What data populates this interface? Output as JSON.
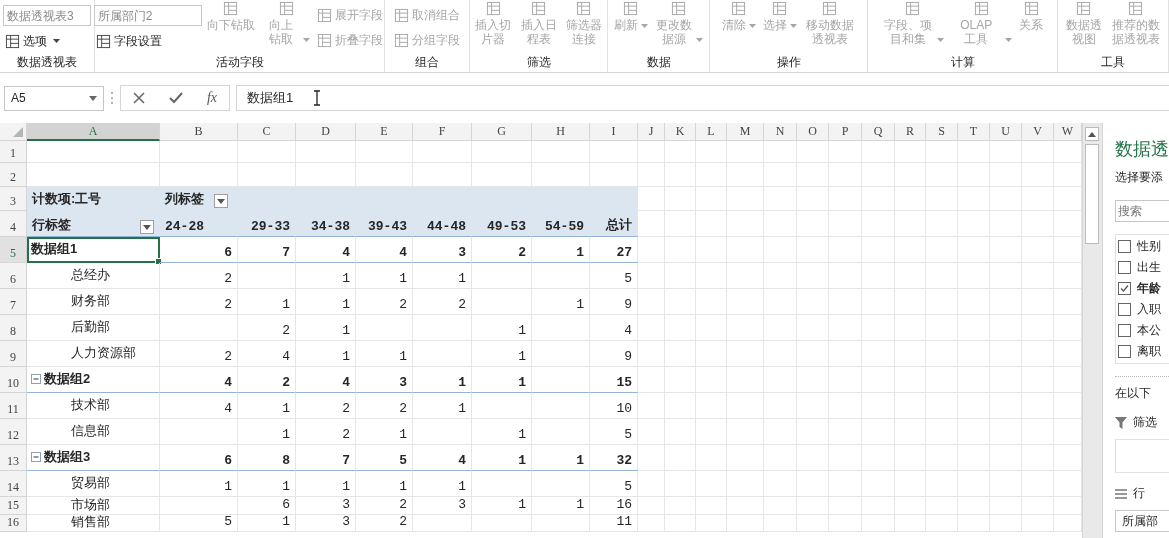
{
  "ribbon": {
    "groups": [
      {
        "name": "数据透视表",
        "items": [
          {
            "kind": "field",
            "label": "数据透视表3"
          },
          {
            "kind": "small",
            "label": "选项",
            "dropdown": true,
            "disabled": false
          }
        ]
      },
      {
        "name": "活动字段",
        "items": [
          {
            "kind": "field",
            "label": "所属部门2"
          },
          {
            "kind": "small",
            "label": "字段设置",
            "dropdown": false,
            "disabled": false
          },
          {
            "kind": "large",
            "label": "向下钻取",
            "dropdown": false,
            "disabled": true
          },
          {
            "kind": "large",
            "label": "向上钻取",
            "dropdown": true,
            "disabled": true
          },
          {
            "kind": "small",
            "label": "展开字段",
            "dropdown": false,
            "disabled": true
          },
          {
            "kind": "small",
            "label": "折叠字段",
            "dropdown": false,
            "disabled": true
          }
        ]
      },
      {
        "name": "组合",
        "items": [
          {
            "kind": "small",
            "label": "取消组合",
            "dropdown": false,
            "disabled": true
          },
          {
            "kind": "small",
            "label": "分组字段",
            "dropdown": false,
            "disabled": true
          }
        ]
      },
      {
        "name": "筛选",
        "items": [
          {
            "kind": "large",
            "label": "插入切片器",
            "dropdown": false,
            "disabled": true
          },
          {
            "kind": "large",
            "label": "插入日程表",
            "dropdown": false,
            "disabled": true
          },
          {
            "kind": "large",
            "label": "筛选器连接",
            "dropdown": false,
            "disabled": true
          }
        ]
      },
      {
        "name": "数据",
        "items": [
          {
            "kind": "large",
            "label": "刷新",
            "dropdown": true,
            "disabled": true
          },
          {
            "kind": "large",
            "label": "更改数据源",
            "dropdown": true,
            "disabled": true
          }
        ]
      },
      {
        "name": "操作",
        "items": [
          {
            "kind": "large",
            "label": "清除",
            "dropdown": true,
            "disabled": true
          },
          {
            "kind": "large",
            "label": "选择",
            "dropdown": true,
            "disabled": true
          },
          {
            "kind": "large",
            "label": "移动数据透视表",
            "dropdown": false,
            "disabled": true
          }
        ]
      },
      {
        "name": "计算",
        "items": [
          {
            "kind": "large",
            "label": "字段、项目和集",
            "dropdown": true,
            "disabled": true
          },
          {
            "kind": "large",
            "label": "OLAP 工具",
            "dropdown": true,
            "disabled": true
          },
          {
            "kind": "large",
            "label": "关系",
            "dropdown": false,
            "disabled": true
          }
        ]
      },
      {
        "name": "工具",
        "items": [
          {
            "kind": "large",
            "label": "数据透视图",
            "dropdown": false,
            "disabled": true
          },
          {
            "kind": "large",
            "label": "推荐的数据透视表",
            "dropdown": false,
            "disabled": true
          }
        ]
      }
    ]
  },
  "formula_bar": {
    "name_box": "A5",
    "function_button": "fx",
    "formula": "数据组1"
  },
  "sheet": {
    "columns": [
      "A",
      "B",
      "C",
      "D",
      "E",
      "F",
      "G",
      "H",
      "I",
      "J",
      "K",
      "L",
      "M",
      "N",
      "O",
      "P",
      "Q",
      "R",
      "S",
      "T",
      "U",
      "V",
      "W"
    ],
    "rows": [
      "1",
      "2",
      "3",
      "4",
      "5",
      "6",
      "7",
      "8",
      "9",
      "10",
      "11",
      "12",
      "13",
      "14",
      "15",
      "16"
    ]
  },
  "pivot": {
    "value_label": "计数项:工号",
    "column_label": "列标签",
    "row_label": "行标签",
    "columns": [
      "24-28",
      "29-33",
      "34-38",
      "39-43",
      "44-48",
      "49-53",
      "54-59",
      "总计"
    ],
    "rows": [
      {
        "kind": "group",
        "label": "数据组1",
        "selected": true,
        "values": {
          "B": "6",
          "C": "7",
          "D": "4",
          "E": "4",
          "F": "3",
          "G": "2",
          "H": "1",
          "I": "27"
        }
      },
      {
        "kind": "item",
        "label": "总经办",
        "selected": false,
        "values": {
          "B": "2",
          "D": "1",
          "E": "1",
          "F": "1",
          "I": "5"
        }
      },
      {
        "kind": "item",
        "label": "财务部",
        "selected": false,
        "values": {
          "B": "2",
          "C": "1",
          "D": "1",
          "E": "2",
          "F": "2",
          "H": "1",
          "I": "9"
        }
      },
      {
        "kind": "item",
        "label": "后勤部",
        "selected": false,
        "values": {
          "C": "2",
          "D": "1",
          "G": "1",
          "I": "4"
        }
      },
      {
        "kind": "item",
        "label": "人力资源部",
        "selected": false,
        "values": {
          "B": "2",
          "C": "4",
          "D": "1",
          "E": "1",
          "G": "1",
          "I": "9"
        }
      },
      {
        "kind": "group",
        "label": "数据组2",
        "selected": false,
        "expanded": true,
        "values": {
          "B": "4",
          "C": "2",
          "D": "4",
          "E": "3",
          "F": "1",
          "G": "1",
          "I": "15"
        }
      },
      {
        "kind": "item",
        "label": "技术部",
        "selected": false,
        "values": {
          "B": "4",
          "C": "1",
          "D": "2",
          "E": "2",
          "F": "1",
          "I": "10"
        }
      },
      {
        "kind": "item",
        "label": "信息部",
        "selected": false,
        "values": {
          "C": "1",
          "D": "2",
          "E": "1",
          "G": "1",
          "I": "5"
        }
      },
      {
        "kind": "group",
        "label": "数据组3",
        "selected": false,
        "expanded": true,
        "values": {
          "B": "6",
          "C": "8",
          "D": "7",
          "E": "5",
          "F": "4",
          "G": "1",
          "H": "1",
          "I": "32"
        }
      },
      {
        "kind": "item",
        "label": "贸易部",
        "selected": false,
        "values": {
          "B": "1",
          "C": "1",
          "D": "1",
          "E": "1",
          "F": "1",
          "I": "5"
        }
      },
      {
        "kind": "item",
        "label": "市场部",
        "selected": false,
        "values": {
          "C": "6",
          "D": "3",
          "E": "2",
          "F": "3",
          "G": "1",
          "H": "1",
          "I": "16"
        }
      },
      {
        "kind": "item",
        "label": "销售部",
        "selected": false,
        "values": {
          "B": "5",
          "C": "1",
          "D": "3",
          "E": "2",
          "I": "11"
        }
      }
    ]
  },
  "pane": {
    "title": "数据透",
    "subtitle": "选择要添",
    "search_placeholder": "搜索",
    "fields": [
      {
        "label": "性别",
        "checked": false
      },
      {
        "label": "出生",
        "checked": false
      },
      {
        "label": "年龄",
        "checked": true
      },
      {
        "label": "入职",
        "checked": false
      },
      {
        "label": "本公",
        "checked": false
      },
      {
        "label": "离职",
        "checked": false
      }
    ],
    "areas_hint": "在以下",
    "areas": [
      {
        "kind": "filter",
        "label": "筛选"
      },
      {
        "kind": "rows",
        "label": "行",
        "items": [
          "所属部"
        ]
      }
    ]
  }
}
